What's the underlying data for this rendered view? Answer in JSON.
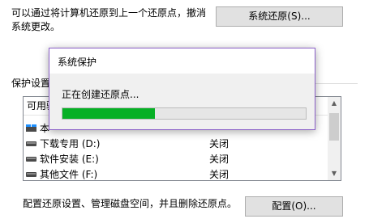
{
  "restore": {
    "description_line1": "可以通过将计算机还原到上一个还原点，撤消",
    "description_line2": "系统更改。",
    "button_label": "系统还原(S)..."
  },
  "protection": {
    "group_label": "保护设置",
    "header_drive": "可用驱",
    "drives": [
      {
        "name": "本",
        "status": "",
        "icon": "system-drive-icon"
      },
      {
        "name": "下载专用 (D:)",
        "status": "关闭",
        "icon": "drive-icon"
      },
      {
        "name": "软件安装 (E:)",
        "status": "关闭",
        "icon": "drive-icon"
      },
      {
        "name": "其他文件 (F:)",
        "status": "关闭",
        "icon": "drive-icon"
      }
    ]
  },
  "configure": {
    "description": "配置还原设置、管理磁盘空间，并且删除还原点。",
    "button_label": "配置(O)..."
  },
  "dialog": {
    "title": "系统保护",
    "message": "正在创建还原点...",
    "progress": 0.38
  },
  "colors": {
    "progress_fill": "#06b025",
    "dialog_border": "#8b60c8",
    "button_bg": "#e1e1e1"
  }
}
